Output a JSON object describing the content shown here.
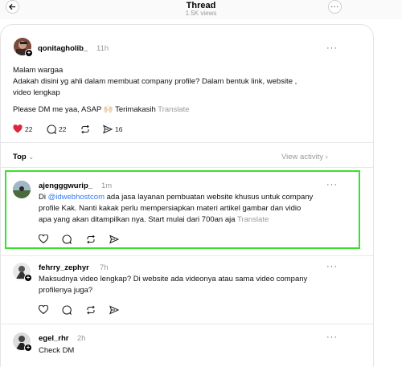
{
  "header": {
    "title": "Thread",
    "views": "1.5K views"
  },
  "post": {
    "username": "qonitagholib_",
    "time": "11h",
    "lines": [
      "Malam wargaa",
      "Adakah disini yg ahli dalam membuat company profile? Dalam bentuk link, website ,",
      "video lengkap"
    ],
    "dm_line": "Please DM me yaa, ASAP 🙌🏻 Terimakasih",
    "translate": "Translate",
    "likes": "22",
    "comments": "22",
    "shares": "16"
  },
  "sort": {
    "label": "Top",
    "view_activity": "View activity"
  },
  "replies": [
    {
      "username": "ajengggwurip_",
      "time": "1m",
      "prefix": "Di ",
      "mention": "@idwebhostcom",
      "rest_line1": " ada jasa layanan pembuatan website khusus untuk company",
      "line2": "profile Kak. Nanti kakak perlu mempersiapkan materi artikel gambar dan vidio",
      "line3": "apa yang akan ditampilkan nya. Start mulai dari 700an aja",
      "translate": "Translate"
    },
    {
      "username": "fehrry_zephyr",
      "time": "7h",
      "line1": "Maksudnya video lengkap? Di website ada videonya atau sama video company",
      "line2": "profilenya juga?"
    },
    {
      "username": "egel_rhr",
      "time": "2h",
      "line1": "Check DM"
    }
  ],
  "colors": {
    "like_red": "#e0243b",
    "highlight": "#39e02e",
    "mention": "#3478f6"
  }
}
